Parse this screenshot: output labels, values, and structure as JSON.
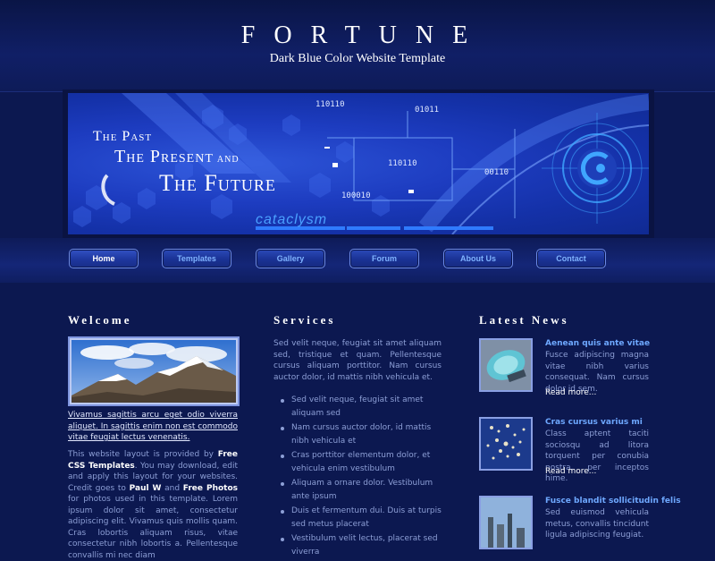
{
  "header": {
    "title": "FORTUNE",
    "subtitle": "Dark Blue Color Website Template"
  },
  "banner": {
    "line1": "The Past",
    "line2": "The Present",
    "line2_small": "and",
    "line3": "The Future",
    "binary": [
      "110110",
      "01011",
      "110110",
      "00110",
      "100010"
    ],
    "brand": "cataclysm"
  },
  "nav": {
    "items": [
      "Home",
      "Templates",
      "Gallery",
      "Forum",
      "About Us",
      "Contact"
    ]
  },
  "welcome": {
    "heading": "Welcome",
    "link_text": "Vivamus sagittis arcu eget odio viverra aliquet. In sagittis enim non est commodo vitae feugiat lectus venenatis.",
    "body_1": "This website layout is provided by ",
    "body_brand": "Free CSS Templates",
    "body_2": ". You may download, edit and apply this layout for your websites. Credit goes to ",
    "body_credit1": "Paul W",
    "body_3": " and ",
    "body_credit2": "Free Photos",
    "body_4": " for photos used in this template. Lorem ipsum dolor sit amet, consectetur adipiscing elit. Vivamus quis mollis quam. Cras lobortis aliquam risus, vitae consectetur nibh lobortis a. Pellentesque convallis mi nec diam"
  },
  "services": {
    "heading": "Services",
    "intro": "Sed velit neque, feugiat sit amet aliquam sed, tristique et quam. Pellentesque cursus aliquam porttitor. Nam cursus auctor dolor, id mattis nibh vehicula et.",
    "items": [
      "Sed velit neque, feugiat sit amet aliquam sed",
      "Nam cursus auctor dolor, id mattis nibh vehicula et",
      "Cras porttitor elementum dolor, et vehicula enim vestibulum",
      "Aliquam a ornare dolor. Vestibulum ante ipsum",
      "Duis et fermentum dui. Duis at turpis sed metus placerat",
      "Vestibulum velit lectus, placerat sed viverra"
    ]
  },
  "news": {
    "heading": "Latest News",
    "items": [
      {
        "title": "Aenean quis ante vitae",
        "text": "Fusce adipiscing magna vitae nibh varius consequat. Nam cursus dolor id sem.",
        "more": "Read more..."
      },
      {
        "title": "Cras cursus varius mi",
        "text": "Class aptent taciti sociosqu ad litora torquent per conubia nostra, per inceptos hime.",
        "more": "Read more..."
      },
      {
        "title": "Fusce blandit sollicitudin felis",
        "text": "Sed euismod vehicula metus, convallis tincidunt ligula adipiscing feugiat.",
        "more": ""
      }
    ]
  },
  "colors": {
    "background": "#0c1850",
    "accent_link": "#6ea8ff",
    "body_text": "#8d9fd6"
  }
}
